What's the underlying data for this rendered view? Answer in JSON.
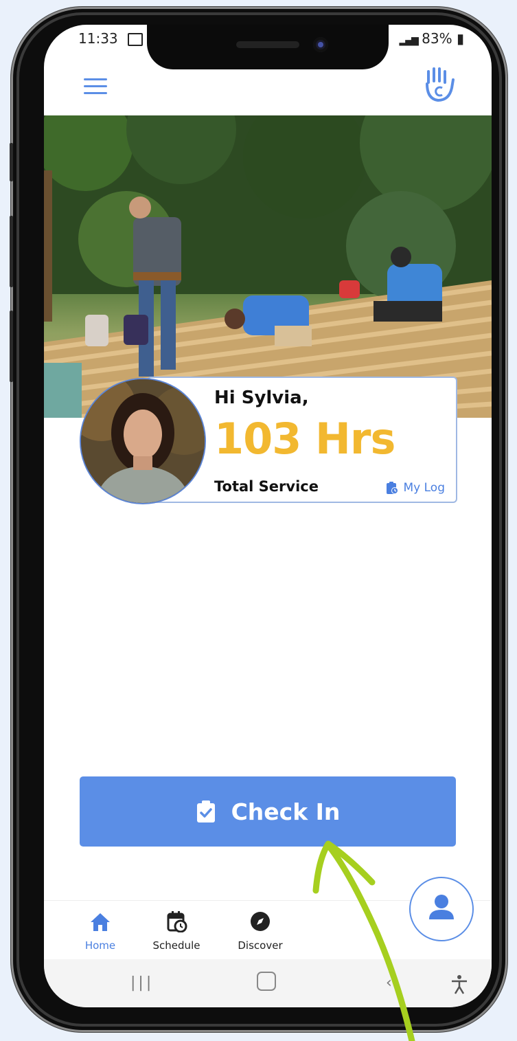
{
  "status_bar": {
    "time": "11:33",
    "battery": "83%"
  },
  "profile": {
    "greeting": "Hi Sylvia,",
    "hours": "103 Hrs",
    "hours_value": 103,
    "total_label": "Total Service",
    "log_link": "My Log"
  },
  "actions": {
    "check_in_label": "Check In"
  },
  "tabs": [
    {
      "label": "Home",
      "icon": "home-icon",
      "active": true
    },
    {
      "label": "Schedule",
      "icon": "calendar-clock-icon",
      "active": false
    },
    {
      "label": "Discover",
      "icon": "compass-icon",
      "active": false
    }
  ],
  "colors": {
    "accent": "#5b8ee6",
    "hours": "#f2b830",
    "arrow": "#a6cf1f"
  }
}
